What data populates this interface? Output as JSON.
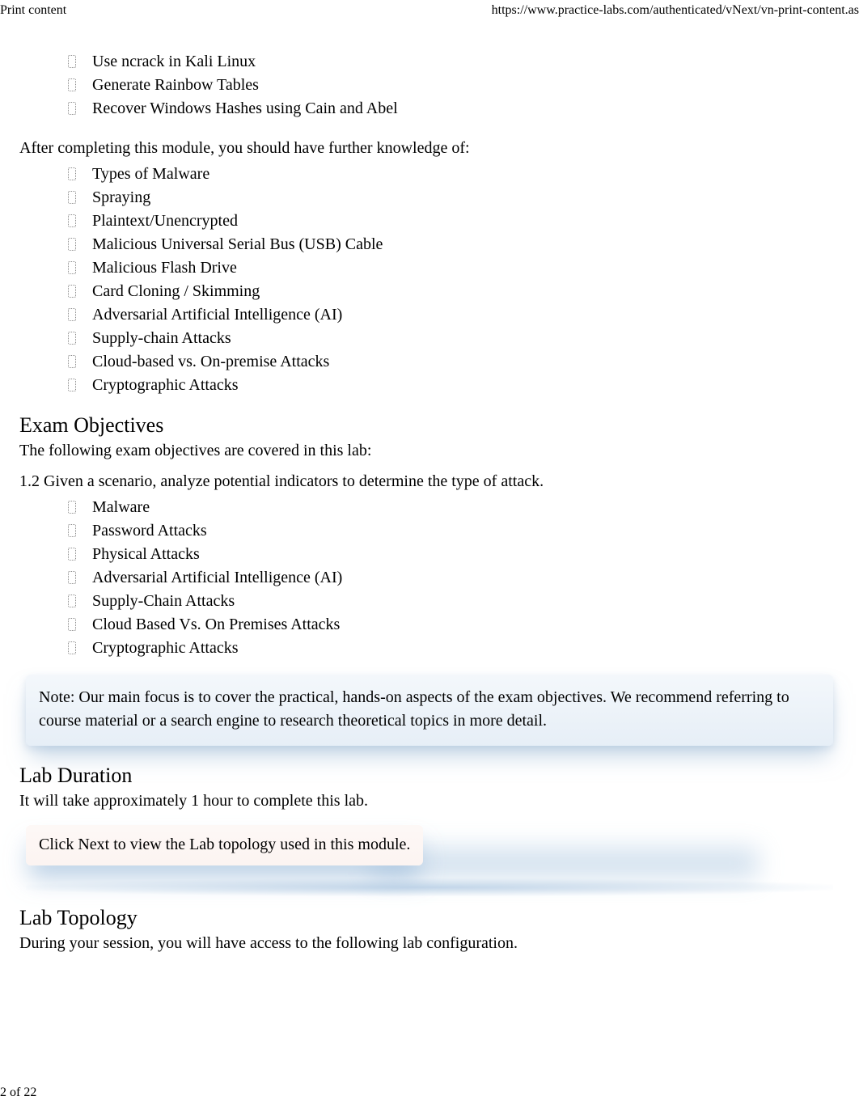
{
  "header": {
    "title": "Print content",
    "url": "https://www.practice-labs.com/authenticated/vNext/vn-print-content.as"
  },
  "tasks_list": [
    "Use ncrack in Kali Linux",
    "Generate Rainbow Tables",
    "Recover Windows Hashes using Cain and Abel"
  ],
  "after_text": "After completing this module, you should have further knowledge of:",
  "knowledge_list": [
    "Types of Malware",
    "Spraying",
    "Plaintext/Unencrypted",
    "Malicious Universal Serial Bus (USB) Cable",
    "Malicious Flash Drive",
    "Card Cloning / Skimming",
    "Adversarial Artificial Intelligence (AI)",
    "Supply-chain Attacks",
    "Cloud-based vs. On-premise Attacks",
    "Cryptographic Attacks"
  ],
  "exam": {
    "heading": "Exam Objectives",
    "intro": "The following exam objectives are covered in this lab:",
    "objective_line": "1.2 Given a scenario, analyze potential indicators to determine the type of attack.",
    "items": [
      "Malware",
      "Password Attacks",
      "Physical Attacks",
      "Adversarial Artificial Intelligence (AI)",
      "Supply-Chain Attacks",
      "Cloud Based Vs. On Premises Attacks",
      "Cryptographic Attacks"
    ]
  },
  "note_text": "Note: Our main focus is to cover the practical, hands-on aspects of the exam objectives. We recommend referring to course material or a search engine to research theoretical topics in more detail.",
  "duration": {
    "heading": "Lab Duration",
    "text": "It will take approximately 1 hour to complete this lab."
  },
  "instruction_text": "Click Next to view the Lab topology used in this module.",
  "topology": {
    "heading": "Lab Topology",
    "text": "During your session, you will have access to the following lab configuration."
  },
  "footer": {
    "page": "2 of 22"
  }
}
